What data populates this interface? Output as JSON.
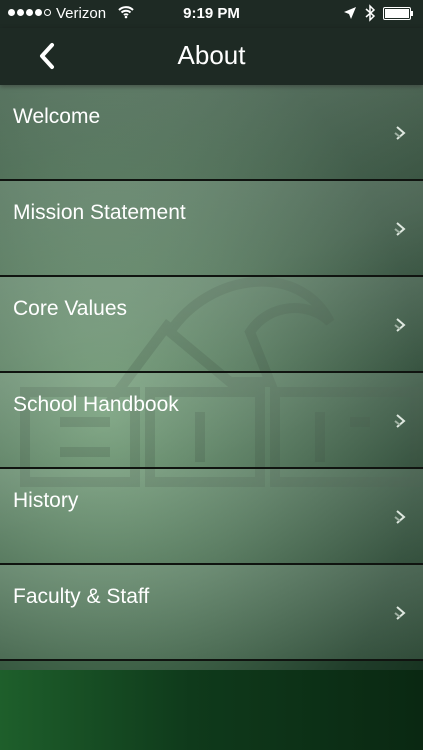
{
  "status_bar": {
    "carrier": "Verizon",
    "time": "9:19 PM"
  },
  "nav": {
    "title": "About",
    "back_icon": "chevron-left-icon"
  },
  "menu": {
    "items": [
      {
        "label": "Welcome"
      },
      {
        "label": "Mission Statement"
      },
      {
        "label": "Core Values"
      },
      {
        "label": "School Handbook"
      },
      {
        "label": "History"
      },
      {
        "label": "Faculty & Staff"
      }
    ],
    "item_icon": "chevron-right-icon"
  },
  "colors": {
    "nav_background": "#1e2a24",
    "text": "#ffffff",
    "brand_green": "#1e5f2b"
  }
}
